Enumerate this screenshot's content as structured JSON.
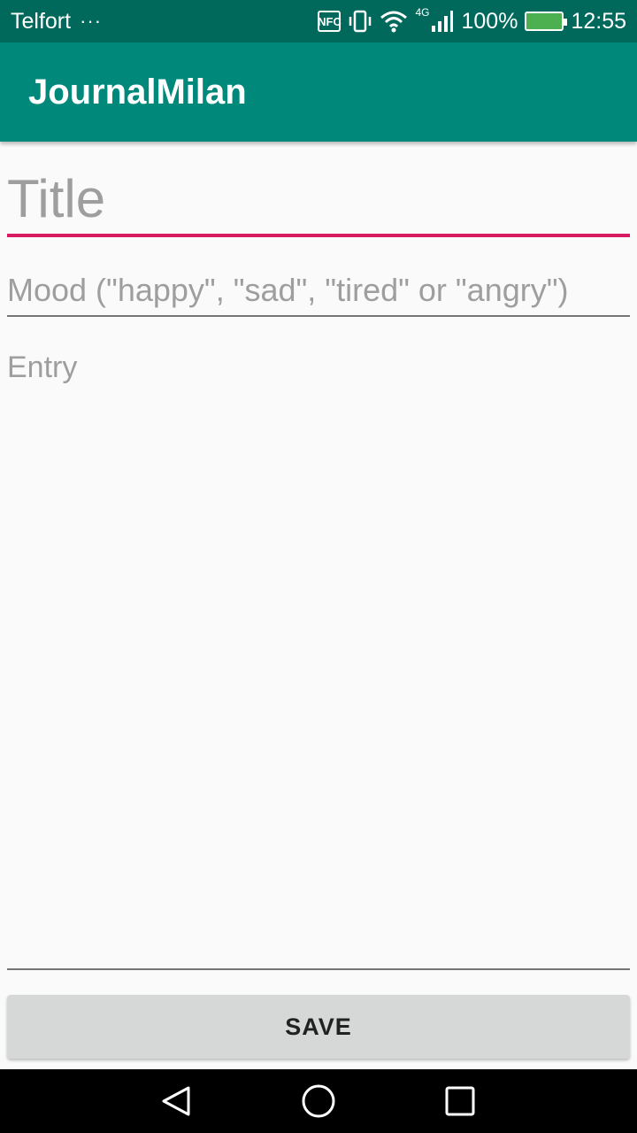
{
  "status_bar": {
    "carrier": "Telfort",
    "more": "···",
    "nfc": "NFC",
    "network": "4G",
    "battery": "100%",
    "time": "12:55"
  },
  "app_bar": {
    "title": "JournalMilan"
  },
  "form": {
    "title_placeholder": "Title",
    "mood_placeholder": "Mood (\"happy\", \"sad\", \"tired\" or \"angry\")",
    "entry_placeholder": "Entry"
  },
  "actions": {
    "save_label": "SAVE"
  },
  "nav_bar": {
    "back_icon": "back-icon",
    "home_icon": "home-icon",
    "recents_icon": "recents-icon"
  },
  "colors": {
    "status_bar": "#00695c",
    "app_bar": "#00897b",
    "accent": "#d81b60",
    "button": "#d6d7d7"
  }
}
